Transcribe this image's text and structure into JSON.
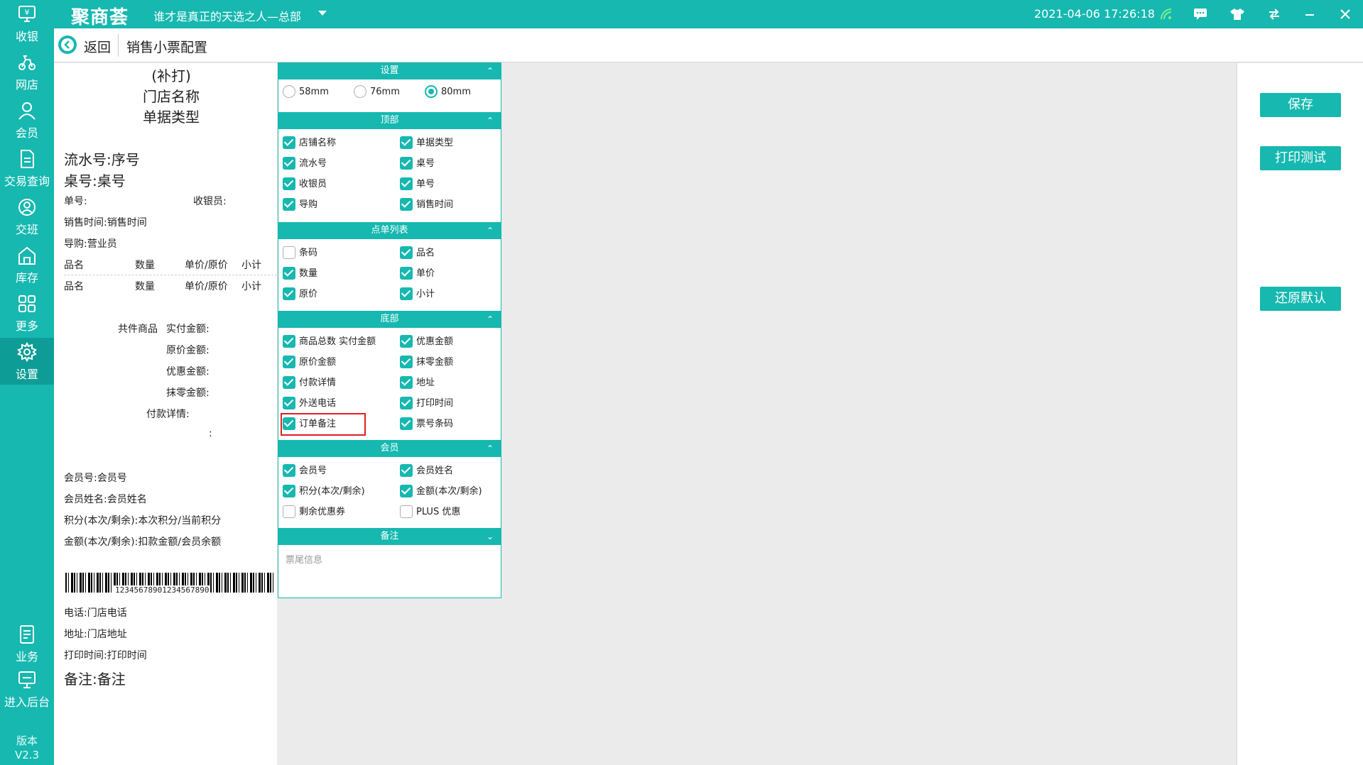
{
  "app": {
    "logo": "聚商荟",
    "store": "谁才是真正的天选之人—总部",
    "datetime": "2021-04-06 17:26:18"
  },
  "sidebar": {
    "items": [
      {
        "label": "收银",
        "icon": "cashier-icon"
      },
      {
        "label": "网店",
        "icon": "online-store-icon"
      },
      {
        "label": "会员",
        "icon": "member-icon"
      },
      {
        "label": "交易查询",
        "icon": "transaction-query-icon"
      },
      {
        "label": "交班",
        "icon": "shift-handover-icon"
      },
      {
        "label": "库存",
        "icon": "inventory-icon"
      },
      {
        "label": "更多",
        "icon": "more-grid-icon"
      },
      {
        "label": "设置",
        "icon": "settings-gear-icon"
      },
      {
        "label": "业务",
        "icon": "business-icon"
      },
      {
        "label": "进入后台",
        "icon": "backend-monitor-icon"
      }
    ],
    "version_label": "版本",
    "version": "V2.3"
  },
  "header": {
    "back": "返回",
    "title": "销售小票配置"
  },
  "receipt": {
    "reprint": "(补打)",
    "store_name": "门店名称",
    "doc_type": "单据类型",
    "serial": "流水号:序号",
    "table": "桌号:桌号",
    "order_no": "单号:",
    "cashier": "收银员:",
    "sale_time": "销售时间:销售时间",
    "guide": "导购:营业员",
    "col_name": "品名",
    "col_qty": "数量",
    "col_price": "单价/原价",
    "col_subtotal": "小计",
    "total_items": "共件商品",
    "paid": "实付金额:",
    "original": "原价金额:",
    "discount": "优惠金额:",
    "rounding": "抹零金额:",
    "pay_detail": "付款详情:",
    "colon": ":",
    "member_no": "会员号:会员号",
    "member_name": "会员姓名:会员姓名",
    "points": "积分(本次/剩余):本次积分/当前积分",
    "amount": "金额(本次/剩余):扣款金额/会员余额",
    "barcode": "12345678901234567890",
    "phone": "电话:门店电话",
    "address": "地址:门店地址",
    "print_time": "打印时间:打印时间",
    "remark": "备注:备注"
  },
  "config": {
    "sections": {
      "settings": "设置",
      "top": "顶部",
      "list": "点单列表",
      "bottom": "底部",
      "member": "会员",
      "remark": "备注"
    },
    "paper": [
      "58mm",
      "76mm",
      "80mm"
    ],
    "paper_selected": "80mm",
    "top": [
      {
        "label": "店铺名称",
        "checked": true
      },
      {
        "label": "单据类型",
        "checked": true
      },
      {
        "label": "流水号",
        "checked": true
      },
      {
        "label": "桌号",
        "checked": true
      },
      {
        "label": "收银员",
        "checked": true
      },
      {
        "label": "单号",
        "checked": true
      },
      {
        "label": "导购",
        "checked": true
      },
      {
        "label": "销售时间",
        "checked": true
      }
    ],
    "list": [
      {
        "label": "条码",
        "checked": false
      },
      {
        "label": "品名",
        "checked": true
      },
      {
        "label": "数量",
        "checked": true
      },
      {
        "label": "单价",
        "checked": true
      },
      {
        "label": "原价",
        "checked": true
      },
      {
        "label": "小计",
        "checked": true
      }
    ],
    "bottom": [
      {
        "label": "商品总数 实付金额",
        "checked": true
      },
      {
        "label": "优惠金额",
        "checked": true
      },
      {
        "label": "原价金额",
        "checked": true
      },
      {
        "label": "抹零金额",
        "checked": true
      },
      {
        "label": "付款详情",
        "checked": true
      },
      {
        "label": "地址",
        "checked": true
      },
      {
        "label": "外送电话",
        "checked": true
      },
      {
        "label": "打印时间",
        "checked": true
      },
      {
        "label": "订单备注",
        "checked": true
      },
      {
        "label": "票号条码",
        "checked": true
      }
    ],
    "member": [
      {
        "label": "会员号",
        "checked": true
      },
      {
        "label": "会员姓名",
        "checked": true
      },
      {
        "label": "积分(本次/剩余)",
        "checked": true
      },
      {
        "label": "金额(本次/剩余)",
        "checked": true
      },
      {
        "label": "剩余优惠券",
        "checked": false
      },
      {
        "label": "PLUS 优惠",
        "checked": false
      }
    ],
    "remark_placeholder": "票尾信息"
  },
  "actions": {
    "save": "保存",
    "print_test": "打印测试",
    "restore": "还原默认"
  },
  "colors": {
    "accent": "#16b8b0",
    "highlight": "#e02020"
  }
}
